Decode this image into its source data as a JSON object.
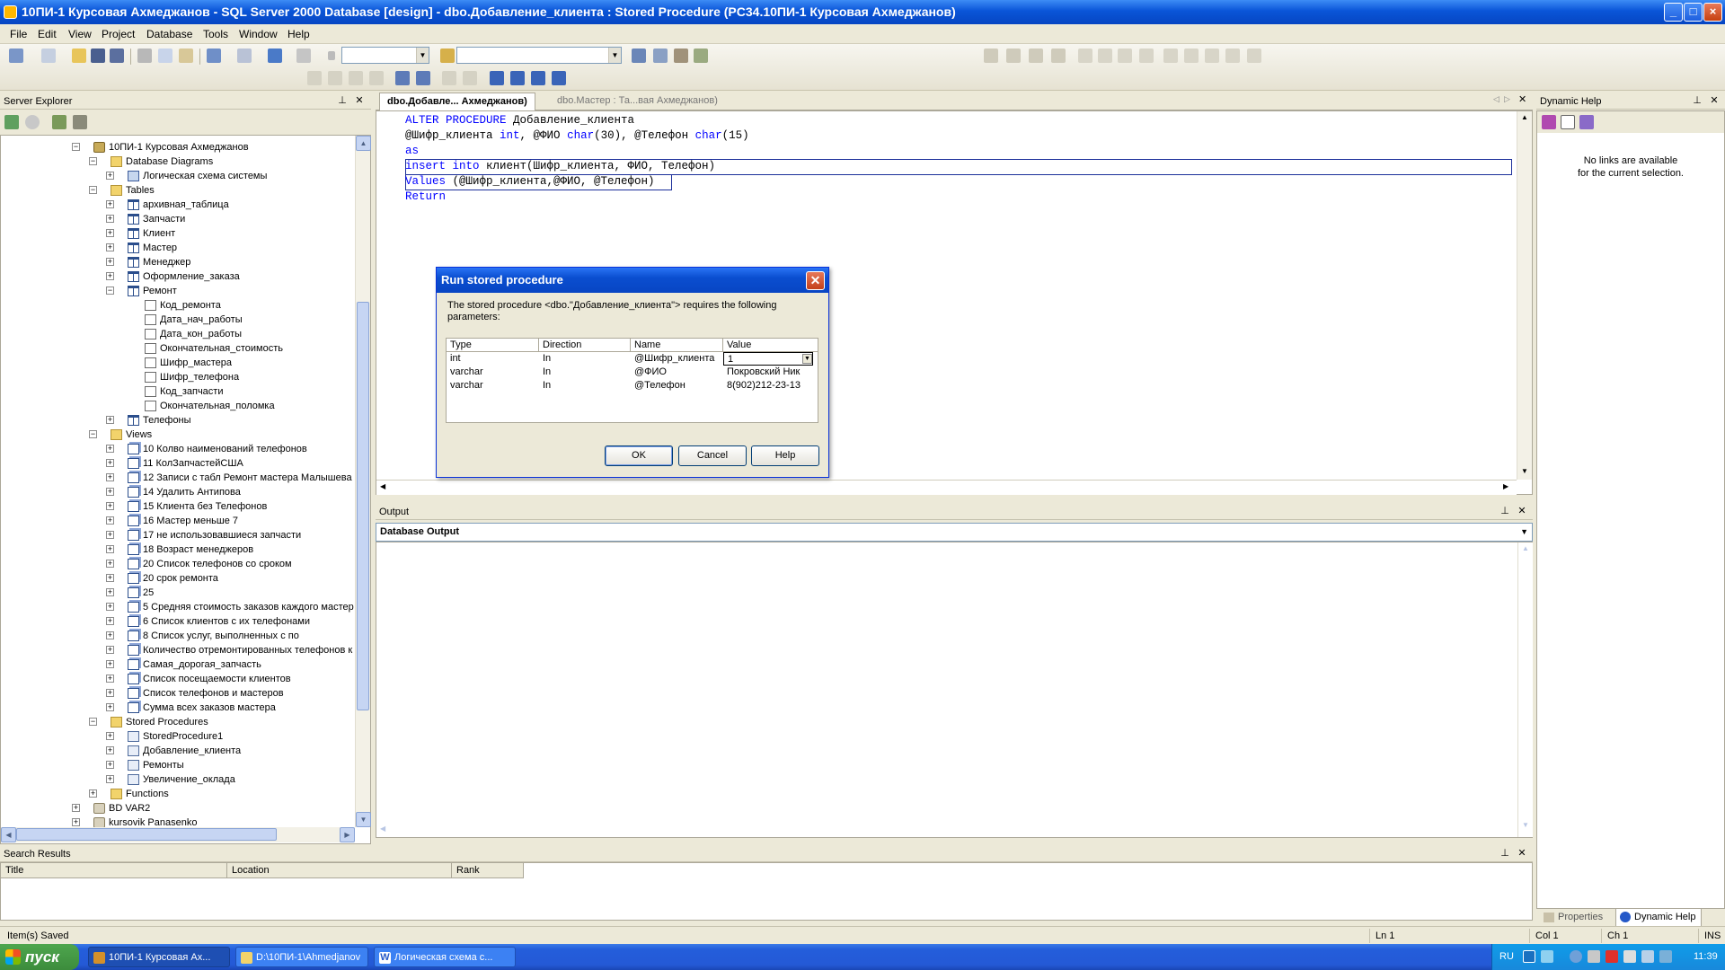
{
  "window": {
    "title": "10ПИ-1 Курсовая Ахмеджанов - SQL Server 2000 Database [design] - dbo.Добавление_клиента : Stored Procedure (PC34.10ПИ-1 Курсовая Ахмеджанов)"
  },
  "menu": [
    "File",
    "Edit",
    "View",
    "Project",
    "Database",
    "Tools",
    "Window",
    "Help"
  ],
  "server_explorer": {
    "title": "Server Explorer",
    "tree": [
      {
        "level": 0,
        "exp": "-",
        "icon": "db",
        "label": "10ПИ-1 Курсовая Ахмеджанов"
      },
      {
        "level": 1,
        "exp": "-",
        "icon": "folder",
        "label": "Database Diagrams"
      },
      {
        "level": 2,
        "exp": "+",
        "icon": "diag",
        "label": "Логическая схема системы"
      },
      {
        "level": 1,
        "exp": "-",
        "icon": "folder",
        "label": "Tables"
      },
      {
        "level": 2,
        "exp": "+",
        "icon": "table",
        "label": "архивная_таблица"
      },
      {
        "level": 2,
        "exp": "+",
        "icon": "table",
        "label": "Запчасти"
      },
      {
        "level": 2,
        "exp": "+",
        "icon": "table",
        "label": "Клиент"
      },
      {
        "level": 2,
        "exp": "+",
        "icon": "table",
        "label": "Мастер"
      },
      {
        "level": 2,
        "exp": "+",
        "icon": "table",
        "label": "Менеджер"
      },
      {
        "level": 2,
        "exp": "+",
        "icon": "table",
        "label": "Оформление_заказа"
      },
      {
        "level": 2,
        "exp": "-",
        "icon": "table",
        "label": "Ремонт"
      },
      {
        "level": 3,
        "exp": "",
        "icon": "col",
        "label": "Код_ремонта"
      },
      {
        "level": 3,
        "exp": "",
        "icon": "col",
        "label": "Дата_нач_работы"
      },
      {
        "level": 3,
        "exp": "",
        "icon": "col",
        "label": "Дата_кон_работы"
      },
      {
        "level": 3,
        "exp": "",
        "icon": "col",
        "label": "Окончательная_стоимость"
      },
      {
        "level": 3,
        "exp": "",
        "icon": "col",
        "label": "Шифр_мастера"
      },
      {
        "level": 3,
        "exp": "",
        "icon": "col",
        "label": "Шифр_телефона"
      },
      {
        "level": 3,
        "exp": "",
        "icon": "col",
        "label": "Код_запчасти"
      },
      {
        "level": 3,
        "exp": "",
        "icon": "col",
        "label": "Окончательная_поломка"
      },
      {
        "level": 2,
        "exp": "+",
        "icon": "table",
        "label": "Телефоны"
      },
      {
        "level": 1,
        "exp": "-",
        "icon": "folder",
        "label": "Views"
      },
      {
        "level": 2,
        "exp": "+",
        "icon": "view",
        "label": "10 Колво наименований телефонов"
      },
      {
        "level": 2,
        "exp": "+",
        "icon": "view",
        "label": "11 КолЗапчастейСША"
      },
      {
        "level": 2,
        "exp": "+",
        "icon": "view",
        "label": "12 Записи с табл Ремонт мастера Малышева"
      },
      {
        "level": 2,
        "exp": "+",
        "icon": "view",
        "label": "14 Удалить Антипова"
      },
      {
        "level": 2,
        "exp": "+",
        "icon": "view",
        "label": "15 Клиента без Телефонов"
      },
      {
        "level": 2,
        "exp": "+",
        "icon": "view",
        "label": "16 Мастер меньше 7"
      },
      {
        "level": 2,
        "exp": "+",
        "icon": "view",
        "label": "17 не использовавшиеся запчасти"
      },
      {
        "level": 2,
        "exp": "+",
        "icon": "view",
        "label": "18 Возраст менеджеров"
      },
      {
        "level": 2,
        "exp": "+",
        "icon": "view",
        "label": "20 Список телефонов со сроком"
      },
      {
        "level": 2,
        "exp": "+",
        "icon": "view",
        "label": "20 срок ремонта"
      },
      {
        "level": 2,
        "exp": "+",
        "icon": "view",
        "label": "25"
      },
      {
        "level": 2,
        "exp": "+",
        "icon": "view",
        "label": "5 Средняя стоимость заказов каждого мастер"
      },
      {
        "level": 2,
        "exp": "+",
        "icon": "view",
        "label": "6 Список клиентов с их телефонами"
      },
      {
        "level": 2,
        "exp": "+",
        "icon": "view",
        "label": "8 Список услуг, выполненных  с по"
      },
      {
        "level": 2,
        "exp": "+",
        "icon": "view",
        "label": "Количество отремонтированных телефонов к"
      },
      {
        "level": 2,
        "exp": "+",
        "icon": "view",
        "label": "Самая_дорогая_запчасть"
      },
      {
        "level": 2,
        "exp": "+",
        "icon": "view",
        "label": "Список посещаемости клиентов"
      },
      {
        "level": 2,
        "exp": "+",
        "icon": "view",
        "label": "Список телефонов и мастеров"
      },
      {
        "level": 2,
        "exp": "+",
        "icon": "view",
        "label": "Сумма всех заказов мастера"
      },
      {
        "level": 1,
        "exp": "-",
        "icon": "folder",
        "label": "Stored Procedures"
      },
      {
        "level": 2,
        "exp": "+",
        "icon": "proc",
        "label": "StoredProcedure1"
      },
      {
        "level": 2,
        "exp": "+",
        "icon": "proc",
        "label": "Добавление_клиента"
      },
      {
        "level": 2,
        "exp": "+",
        "icon": "proc",
        "label": "Ремонты"
      },
      {
        "level": 2,
        "exp": "+",
        "icon": "proc",
        "label": "Увеличение_оклада"
      },
      {
        "level": 1,
        "exp": "+",
        "icon": "folder",
        "label": "Functions"
      },
      {
        "level": 0,
        "exp": "+",
        "icon": "server",
        "label": "BD VAR2"
      },
      {
        "level": 0,
        "exp": "+",
        "icon": "server",
        "label": "kursovik Panasenko"
      }
    ]
  },
  "doc_tabs": {
    "active": "dbo.Добавле... Ахмеджанов)",
    "inactive": "dbo.Мастер : Та...вая Ахмеджанов)"
  },
  "editor": {
    "lines": [
      [
        {
          "t": "ALTER PROCEDURE",
          "k": true
        },
        {
          "t": " Добавление_клиента",
          "k": false
        }
      ],
      [
        {
          "t": "@Шифр_клиента ",
          "k": false
        },
        {
          "t": "int",
          "k": true
        },
        {
          "t": ", @ФИО ",
          "k": false
        },
        {
          "t": "char",
          "k": true
        },
        {
          "t": "(30), @Телефон ",
          "k": false
        },
        {
          "t": "char",
          "k": true
        },
        {
          "t": "(15)",
          "k": false
        }
      ],
      [
        {
          "t": "as",
          "k": true
        }
      ],
      [
        {
          "t": "insert into",
          "k": true
        },
        {
          "t": " клиент(Шифр_клиента, ФИО, Телефон)",
          "k": false
        }
      ],
      [
        {
          "t": "Values",
          "k": true
        },
        {
          "t": " (@Шифр_клиента,@ФИО, @Телефон)",
          "k": false
        }
      ],
      [
        {
          "t": "Return",
          "k": true
        }
      ]
    ]
  },
  "output": {
    "title": "Output",
    "combo": "Database Output"
  },
  "dynamic_help": {
    "title": "Dynamic Help",
    "message_line1": "No links are available",
    "message_line2": "for the current selection.",
    "tab_properties": "Properties",
    "tab_dynamic_help": "Dynamic Help"
  },
  "search_results": {
    "title": "Search Results",
    "columns": [
      "Title",
      "Location",
      "Rank"
    ]
  },
  "status": {
    "message": "Item(s) Saved",
    "ln": "Ln 1",
    "col": "Col 1",
    "ch": "Ch 1",
    "ins": "INS"
  },
  "dialog": {
    "title": "Run stored procedure",
    "message": "The stored procedure <dbo.\"Добавление_клиента\"> requires the following parameters:",
    "columns": [
      "Type",
      "Direction",
      "Name",
      "Value"
    ],
    "rows": [
      {
        "type": "int",
        "direction": "In",
        "name": "@Шифр_клиента",
        "value": "1"
      },
      {
        "type": "varchar",
        "direction": "In",
        "name": "@ФИО",
        "value": "Покровский Ник"
      },
      {
        "type": "varchar",
        "direction": "In",
        "name": "@Телефон",
        "value": "8(902)212-23-13"
      }
    ],
    "ok": "OK",
    "cancel": "Cancel",
    "help": "Help"
  },
  "taskbar": {
    "start": "пуск",
    "tasks": [
      {
        "label": "10ПИ-1 Курсовая Ах...",
        "active": true
      },
      {
        "label": "D:\\10ПИ-1\\Ahmedjanov",
        "active": false
      },
      {
        "label": "Логическая схема с...",
        "active": false
      }
    ],
    "lang": "RU",
    "clock": "11:39"
  },
  "colors": {
    "keyword": "#0000ff",
    "titlebar": "#0a55d8",
    "taskbar": "#245edb"
  }
}
